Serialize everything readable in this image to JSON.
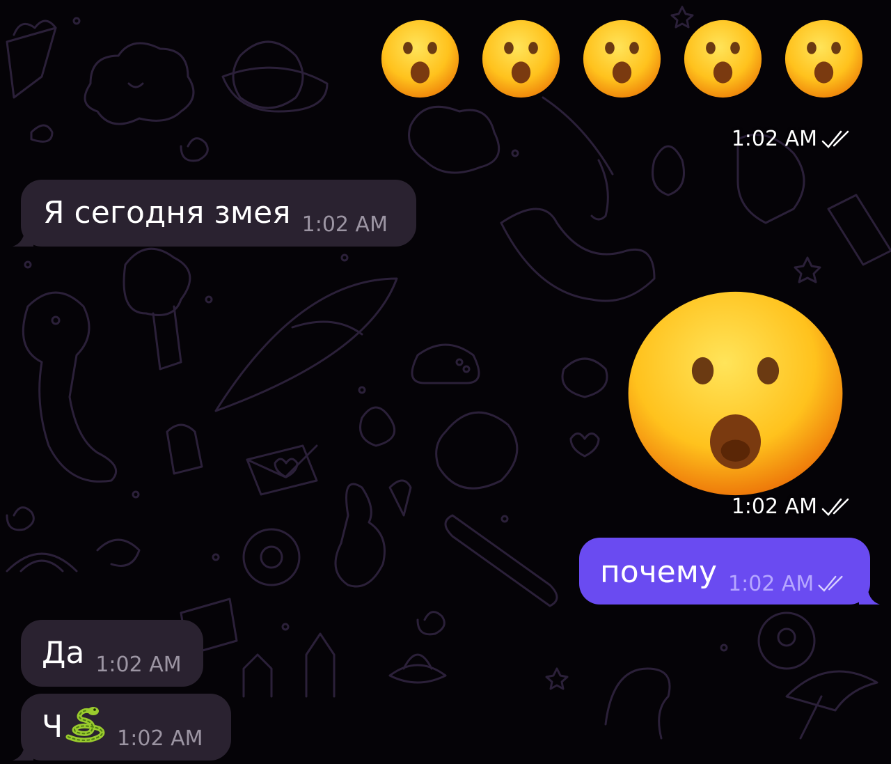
{
  "chat": {
    "top_emojis": [
      {
        "icon": "hushed-face-emoji"
      },
      {
        "icon": "hushed-face-emoji"
      },
      {
        "icon": "hushed-face-emoji"
      },
      {
        "icon": "hushed-face-emoji"
      },
      {
        "icon": "hushed-face-emoji"
      }
    ],
    "top_emojis_time": "1:02 AM",
    "msg1": {
      "text": "Я сегодня змея",
      "time": "1:02 AM"
    },
    "big_emoji": {
      "icon": "hushed-face-emoji",
      "time": "1:02 AM"
    },
    "msg2": {
      "text": "почему",
      "time": "1:02 AM"
    },
    "msg3": {
      "text": "Да",
      "time": "1:02 AM"
    },
    "msg4": {
      "text": "Ч",
      "emoji": "snake-emoji",
      "time": "1:02 AM"
    }
  },
  "colors": {
    "background": "#050307",
    "doodle_stroke": "#2a1f38",
    "incoming_bubble": "#2a2230",
    "outgoing_bubble": "#6a4bf1",
    "timestamp_incoming": "#9c95a3",
    "timestamp_outgoing": "#b6a7ff"
  }
}
